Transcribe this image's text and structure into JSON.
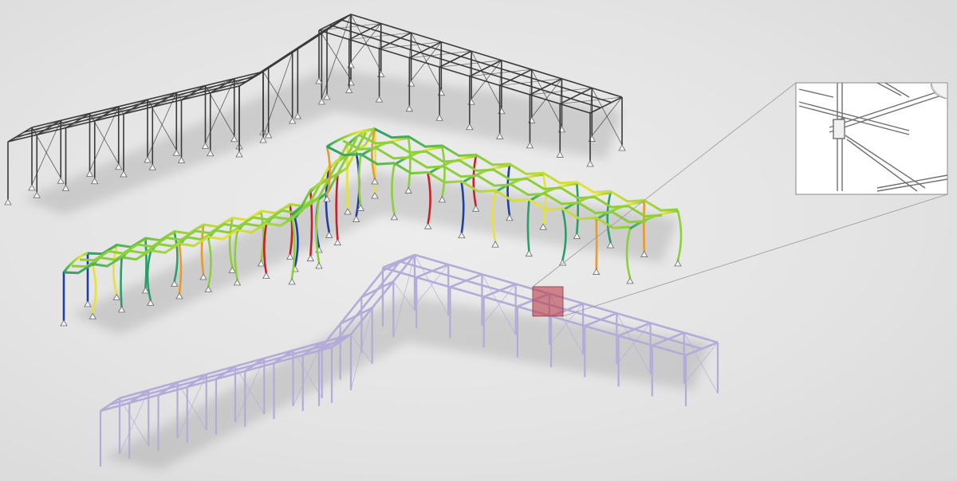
{
  "palette": {
    "background": "#e6e6e6",
    "wireframe": "#3a3a3a",
    "lavender_frame": "#b9b0dc",
    "highlight": "#b8404a",
    "fea_colors": [
      "#1f3fa8",
      "#2a9e6a",
      "#8ccf3a",
      "#e6e23a",
      "#e89a2a",
      "#c8202a"
    ]
  },
  "icons": {
    "page_curl": "page-curl-icon",
    "support": "support-triangle-icon"
  }
}
